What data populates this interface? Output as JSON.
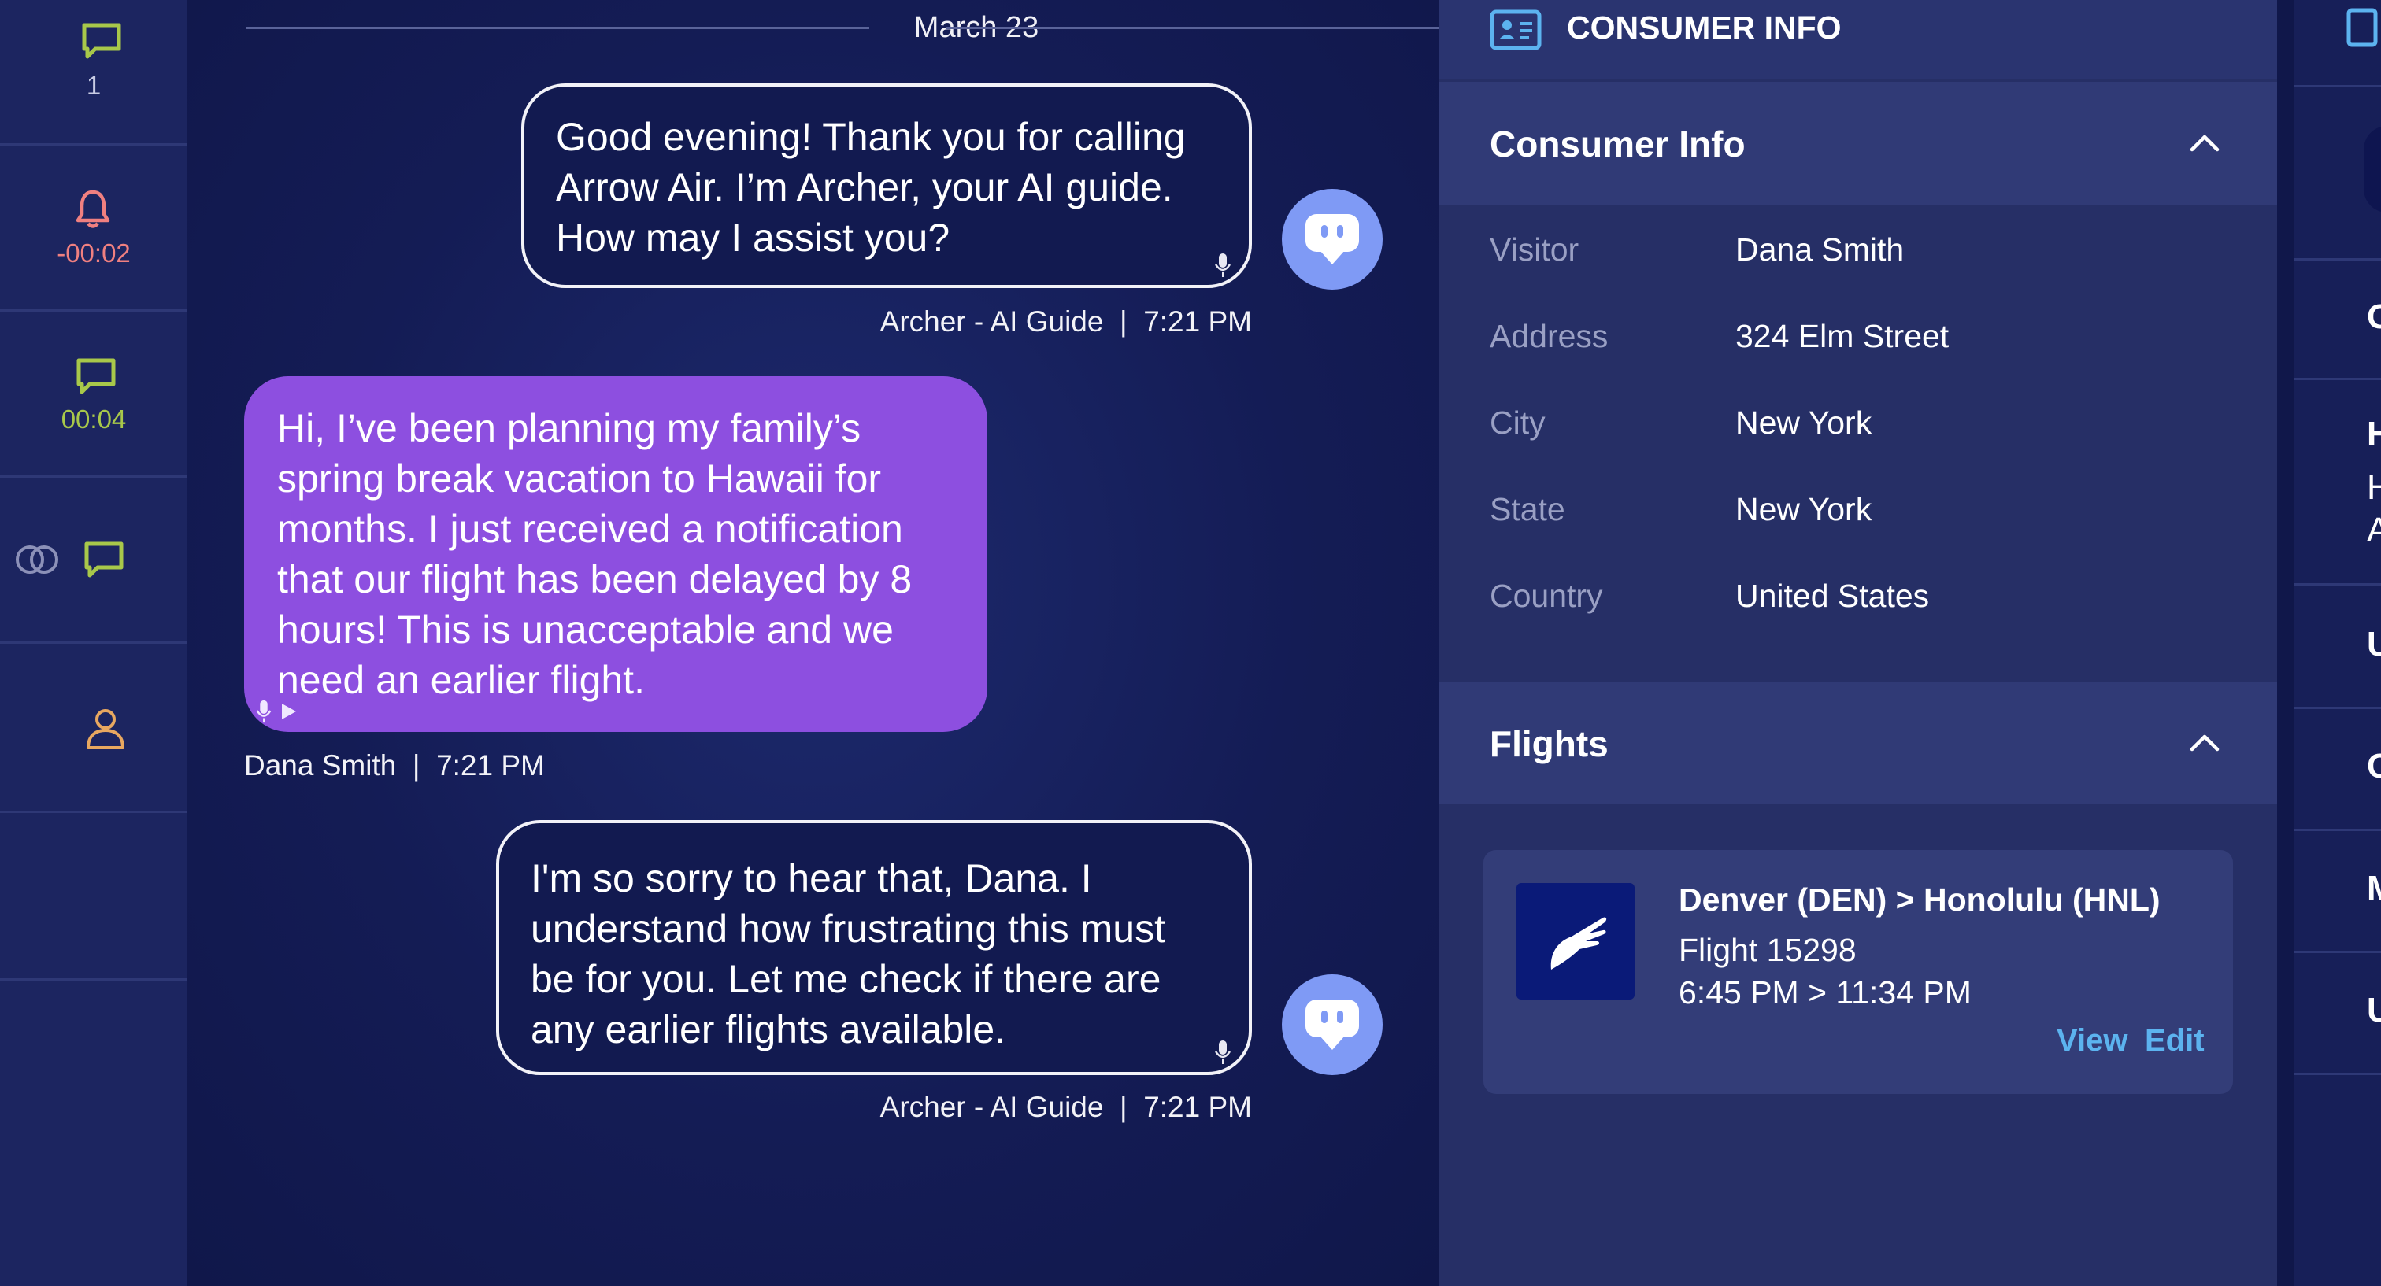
{
  "rail": {
    "item1_count": "1",
    "item2_timer": "-00:02",
    "item3_timer": "00:04"
  },
  "chat": {
    "date": "March 23",
    "messages": [
      {
        "sender": "Archer - AI Guide",
        "time": "7:21 PM",
        "text_lines": [
          "Good evening! Thank you for calling",
          "Arrow Air. I’m Archer, your AI guide.",
          "How may I assist you?"
        ]
      },
      {
        "sender": "Dana Smith",
        "time": "7:21 PM",
        "text_lines": [
          "Hi, I’ve been planning my family’s",
          "spring break vacation to Hawaii for",
          "months. I just received a notification",
          "that our flight has been delayed by 8",
          "hours! This is unacceptable and we",
          "need an earlier flight."
        ]
      },
      {
        "sender": "Archer - AI Guide",
        "time": "7:21 PM",
        "text_lines": [
          "I'm so sorry to hear that, Dana. I",
          "understand how frustrating this must",
          "be for you. Let me check if there are",
          "any earlier flights available."
        ]
      }
    ],
    "separator": "|"
  },
  "panel": {
    "title": "CONSUMER INFO",
    "consumer_section_title": "Consumer Info",
    "fields": [
      {
        "label": "Visitor",
        "value": "Dana Smith"
      },
      {
        "label": "Address",
        "value": "324 Elm Street"
      },
      {
        "label": "City",
        "value": "New York"
      },
      {
        "label": "State",
        "value": "New York"
      },
      {
        "label": "Country",
        "value": "United States"
      }
    ],
    "flights_section_title": "Flights",
    "flight": {
      "route": "Denver (DEN) > Honolulu (HNL)",
      "number": "Flight 15298",
      "times": "6:45 PM > 11:34 PM",
      "view_label": "View",
      "edit_label": "Edit"
    }
  },
  "far_right": {
    "items": [
      "Gr",
      "He",
      "Up",
      "Ca",
      "M",
      "Up"
    ],
    "sub_lines": [
      "He",
      "Ar"
    ]
  },
  "colors": {
    "accent_green": "#a8c84a",
    "alert_red": "#f08080",
    "user_bubble": "#8d4fe0",
    "link_blue": "#5cb3ef",
    "avatar_blue": "#7f9af5"
  }
}
